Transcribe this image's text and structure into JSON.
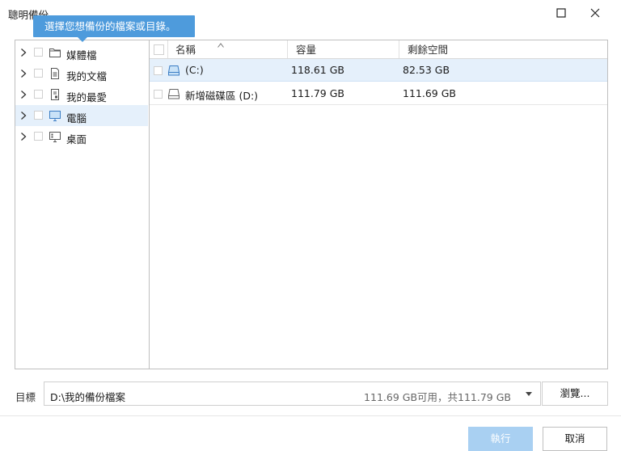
{
  "window": {
    "title": "聰明備份",
    "minimize_icon": "minimize-icon",
    "close_icon": "close-icon"
  },
  "tooltip": {
    "text": "選擇您想備份的檔案或目錄。"
  },
  "tree": {
    "items": [
      {
        "label": "媒體檔",
        "icon": "folder-icon",
        "selected": false
      },
      {
        "label": "我的文檔",
        "icon": "document-icon",
        "selected": false
      },
      {
        "label": "我的最愛",
        "icon": "favorites-icon",
        "selected": false
      },
      {
        "label": "電腦",
        "icon": "computer-icon",
        "selected": true
      },
      {
        "label": "桌面",
        "icon": "desktop-icon",
        "selected": false
      }
    ]
  },
  "list": {
    "columns": [
      "名稱",
      "容量",
      "剩餘空間"
    ],
    "rows": [
      {
        "name": "(C:)",
        "capacity": "118.61 GB",
        "free": "82.53 GB",
        "icon": "system-drive-icon",
        "selected": true
      },
      {
        "name": "新增磁碟區 (D:)",
        "capacity": "111.79 GB",
        "free": "111.69 GB",
        "icon": "drive-icon",
        "selected": false
      }
    ]
  },
  "target": {
    "label": "目標",
    "path": "D:\\我的備份檔案",
    "space": "111.69 GB可用，共111.79 GB"
  },
  "buttons": {
    "browse": "瀏覽...",
    "execute": "執行",
    "cancel": "取消"
  },
  "colors": {
    "accent": "#4e9bdc",
    "selection": "#e5f0fb",
    "execute_disabled": "#a9d0f2"
  }
}
